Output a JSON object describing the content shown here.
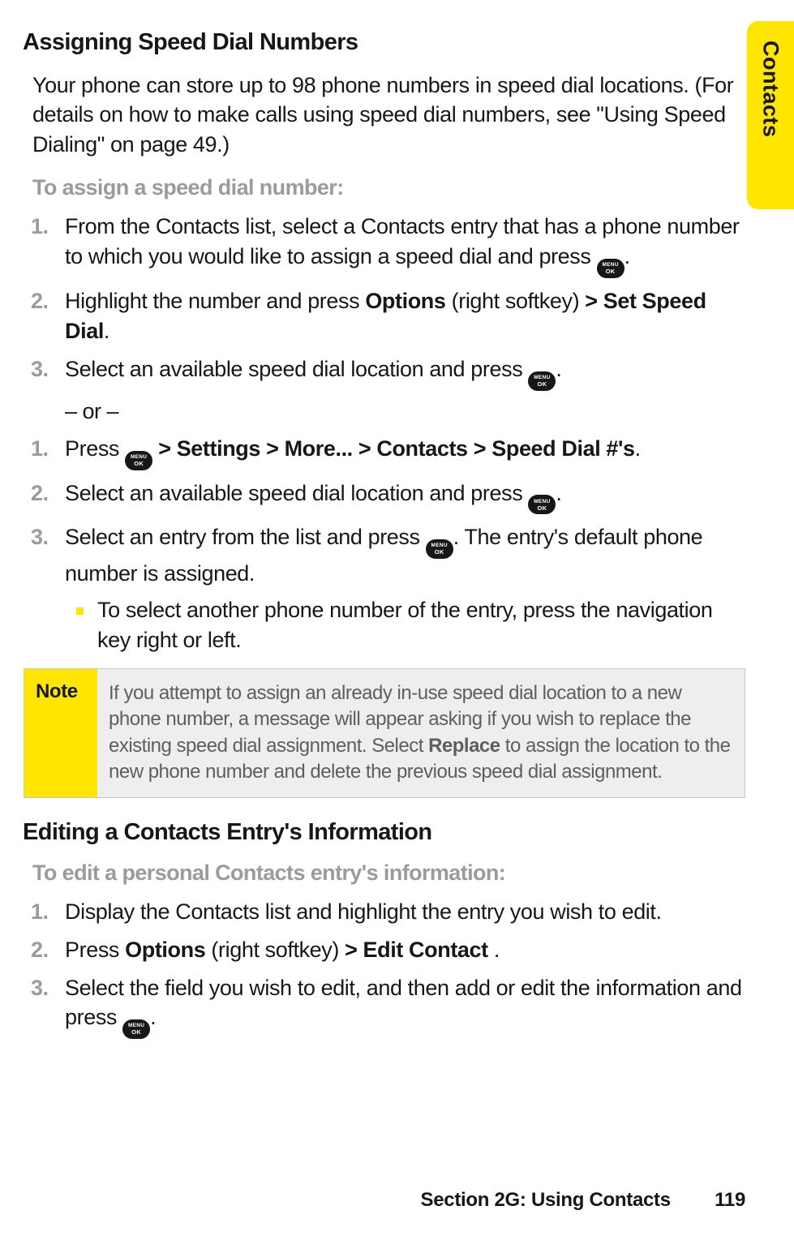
{
  "sideTab": "Contacts",
  "sec1_title": "Assigning Speed Dial Numbers",
  "sec1_intro": "Your phone can store up to 98 phone numbers in speed dial locations. (For details on how to make calls using speed dial numbers, see \"Using Speed Dialing\" on page 49.)",
  "sec1_sub": "To assign a speed dial number:",
  "la1_n": "1.",
  "la1_a": "From the Contacts list, select a Contacts entry that has a phone number to which you would like to assign a speed dial and press ",
  "la1_b": ".",
  "la2_n": "2.",
  "la2_a": "Highlight the number and press ",
  "la2_b1": "Options",
  "la2_c": " (right softkey) ",
  "la2_b2": "> Set Speed Dial",
  "la2_d": ".",
  "la3_n": "3.",
  "la3_a": "Select an available speed dial location and press ",
  "la3_b": ".",
  "or_sep": "– or –",
  "lb1_n": "1.",
  "lb1_a": "Press ",
  "lb1_b": " > Settings > More... > Contacts > Speed Dial #'s",
  "lb1_c": ".",
  "lb2_n": "2.",
  "lb2_a": "Select an available speed dial location and press ",
  "lb2_b": ".",
  "lb3_n": "3.",
  "lb3_a": "Select an entry from the list and press ",
  "lb3_b": ". The entry's default phone number is assigned.",
  "lb3_sub": "To select another phone number of the entry, press the navigation key right or left.",
  "note_label": "Note",
  "note_a": "If you attempt to assign an already in-use speed dial location to a new phone number, a message will appear asking if you wish to replace the existing speed dial assignment. Select ",
  "note_b": "Replace",
  "note_c": " to assign the location to the new phone number and delete the previous speed dial assignment.",
  "sec2_title": "Editing a Contacts Entry's Information",
  "sec2_sub": "To edit a personal Contacts entry's information:",
  "e1_n": "1.",
  "e1_a": "Display the Contacts list and highlight the entry you wish to edit.",
  "e2_n": "2.",
  "e2_a": "Press ",
  "e2_b1": "Options",
  "e2_b": " (right softkey) ",
  "e2_b2": "> Edit Contact",
  "e2_c": " .",
  "e3_n": "3.",
  "e3_a": "Select the field you wish to edit, and then add or edit the information and press ",
  "e3_b": ".",
  "footer_sec": "Section 2G: Using Contacts",
  "footer_pg": "119",
  "menu_top": "MENU",
  "menu_bot": "OK"
}
